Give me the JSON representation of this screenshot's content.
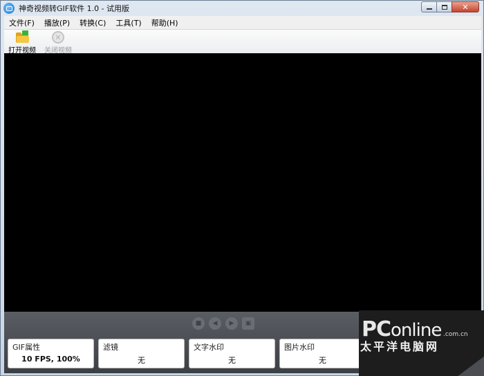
{
  "window": {
    "title": "神奇视频转GIF软件 1.0 - 试用版"
  },
  "menu": {
    "items": [
      "文件(F)",
      "播放(P)",
      "转换(C)",
      "工具(T)",
      "帮助(H)"
    ]
  },
  "toolbar": {
    "open_label": "打开视频",
    "close_label": "关闭视频"
  },
  "playback": {
    "icons": [
      "stop-icon",
      "previous-frame-icon",
      "next-frame-icon",
      "snapshot-icon"
    ]
  },
  "cards": [
    {
      "title": "GIF属性",
      "value": "10 FPS, 100%"
    },
    {
      "title": "滤镜",
      "value": "无"
    },
    {
      "title": "文字水印",
      "value": "无"
    },
    {
      "title": "图片水印",
      "value": "无"
    }
  ],
  "watermark": {
    "brand_p": "PC",
    "brand_rest": "online",
    "domain": ".com.cn",
    "cn_text": "太平洋电脑网"
  }
}
